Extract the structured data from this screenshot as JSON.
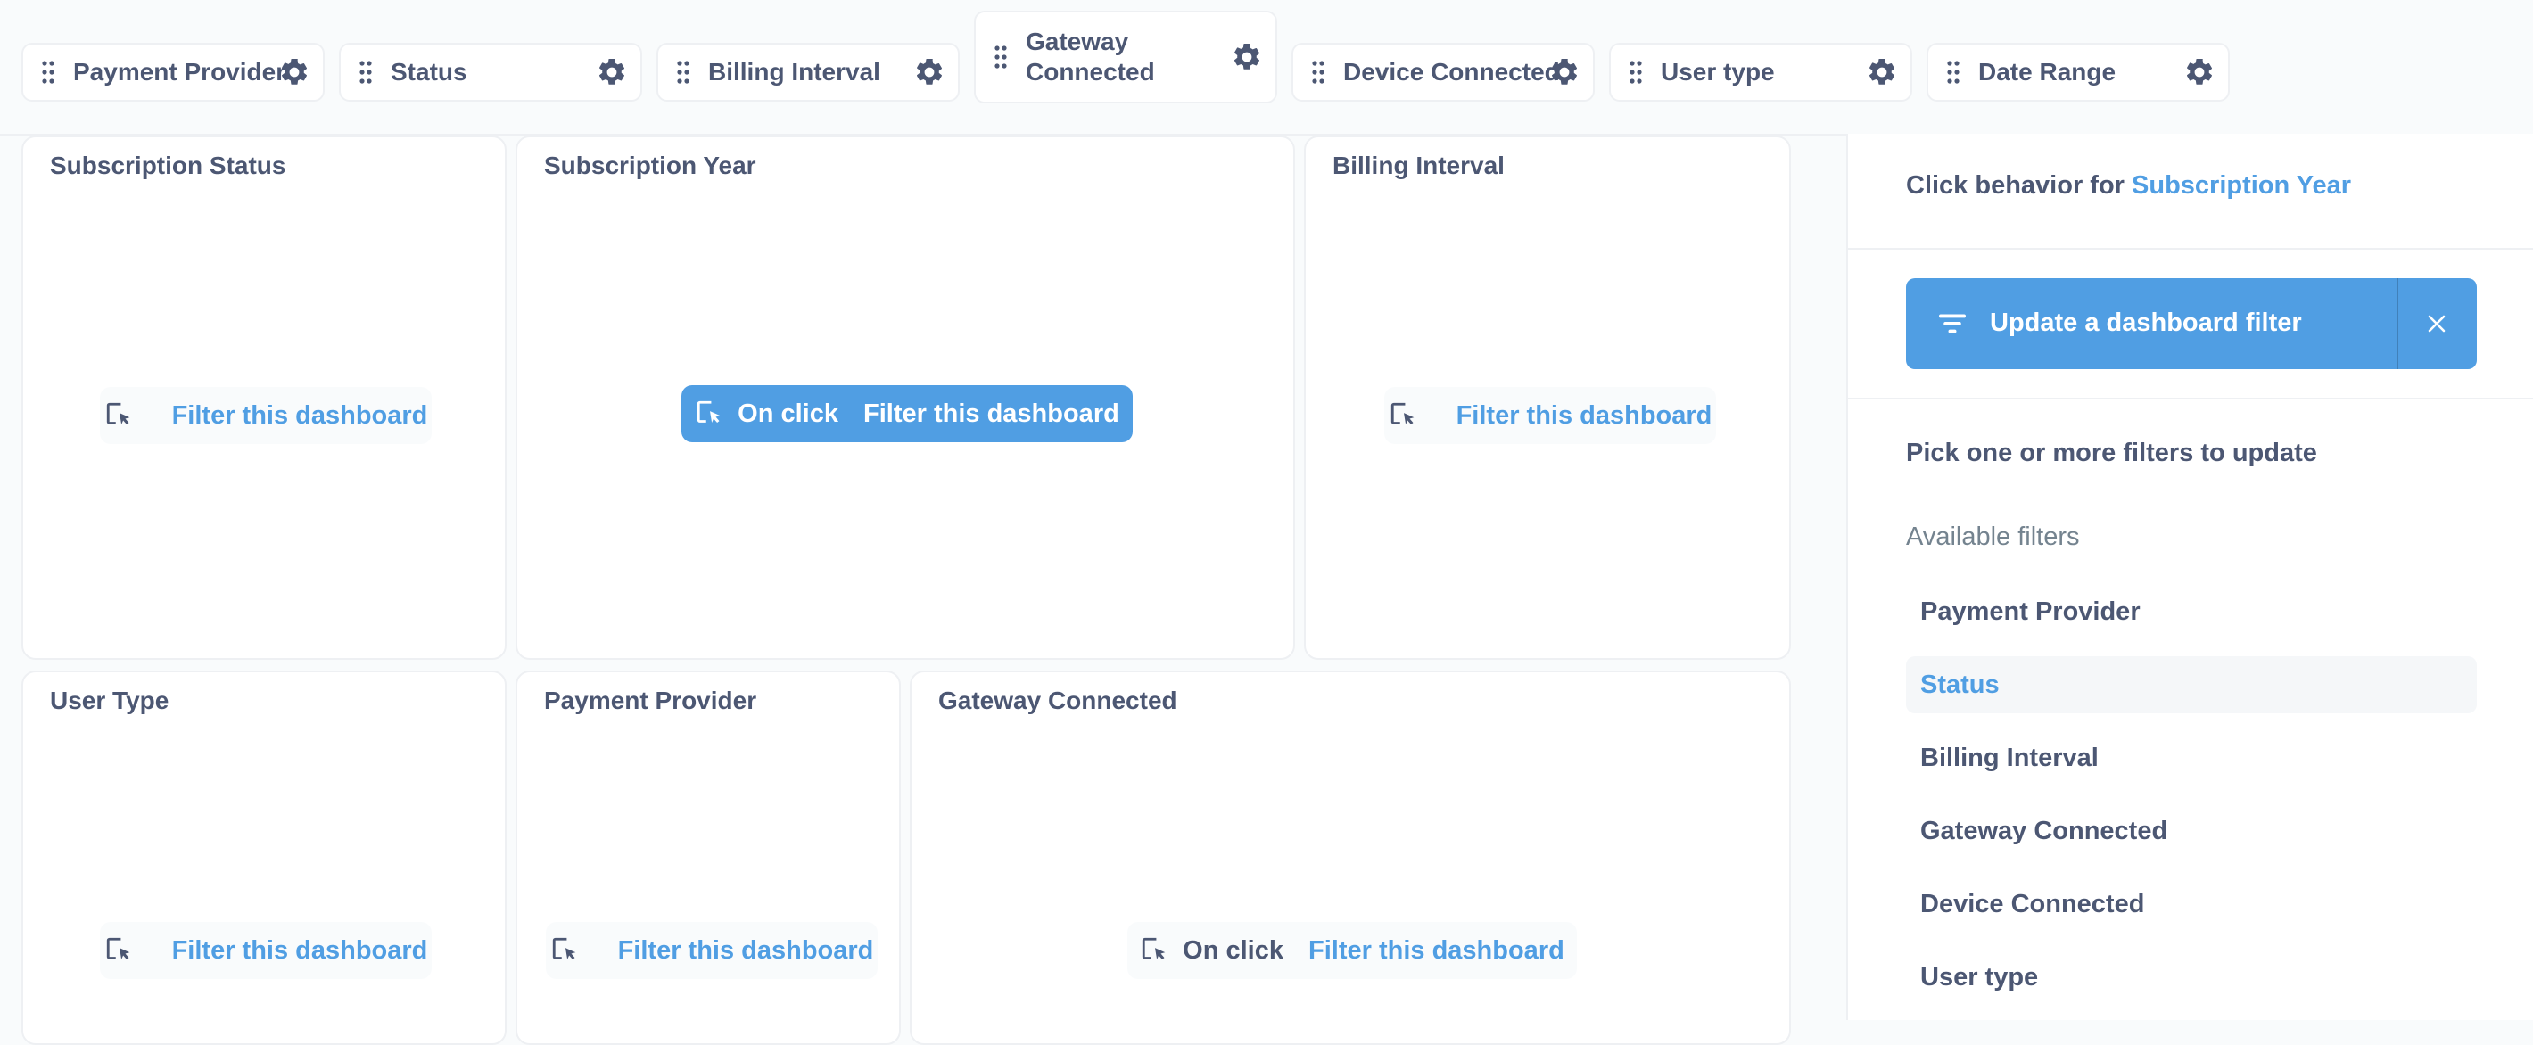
{
  "filters": [
    {
      "label": "Payment Provider"
    },
    {
      "label": "Status"
    },
    {
      "label": "Billing Interval"
    },
    {
      "label": "Gateway Connected"
    },
    {
      "label": "Device Connected"
    },
    {
      "label": "User type"
    },
    {
      "label": "Date Range"
    }
  ],
  "cards": [
    {
      "title": "Subscription Status",
      "pill_on": "",
      "pill_label": "Filter this dashboard",
      "active": false
    },
    {
      "title": "Subscription Year",
      "pill_on": "On click",
      "pill_label": "Filter this dashboard",
      "active": true
    },
    {
      "title": "Billing Interval",
      "pill_on": "",
      "pill_label": "Filter this dashboard",
      "active": false
    },
    {
      "title": "User Type",
      "pill_on": "",
      "pill_label": "Filter this dashboard",
      "active": false
    },
    {
      "title": "Payment Provider",
      "pill_on": "",
      "pill_label": "Filter this dashboard",
      "active": false
    },
    {
      "title": "Gateway Connected",
      "pill_on": "On click",
      "pill_label": "Filter this dashboard",
      "active": false
    }
  ],
  "sidebar": {
    "header_prefix": "Click behavior for",
    "header_link": "Subscription Year",
    "action_button": "Update a dashboard filter",
    "pick_label": "Pick one or more filters to update",
    "available_label": "Available filters",
    "items": [
      {
        "label": "Payment Provider",
        "selected": false
      },
      {
        "label": "Status",
        "selected": true
      },
      {
        "label": "Billing Interval",
        "selected": false
      },
      {
        "label": "Gateway Connected",
        "selected": false
      },
      {
        "label": "Device Connected",
        "selected": false
      },
      {
        "label": "User type",
        "selected": false
      }
    ]
  },
  "colors": {
    "accent": "#509ee3",
    "text": "#4c5773",
    "muted": "#74838f",
    "border": "#eef0f3",
    "background": "#f9fbfc"
  },
  "icons": {
    "filter_handle": "drag-handle-icon",
    "filter_settings": "gear-icon",
    "pill": "click-cursor-icon",
    "action": "filter-lines-icon",
    "close": "close-icon"
  }
}
